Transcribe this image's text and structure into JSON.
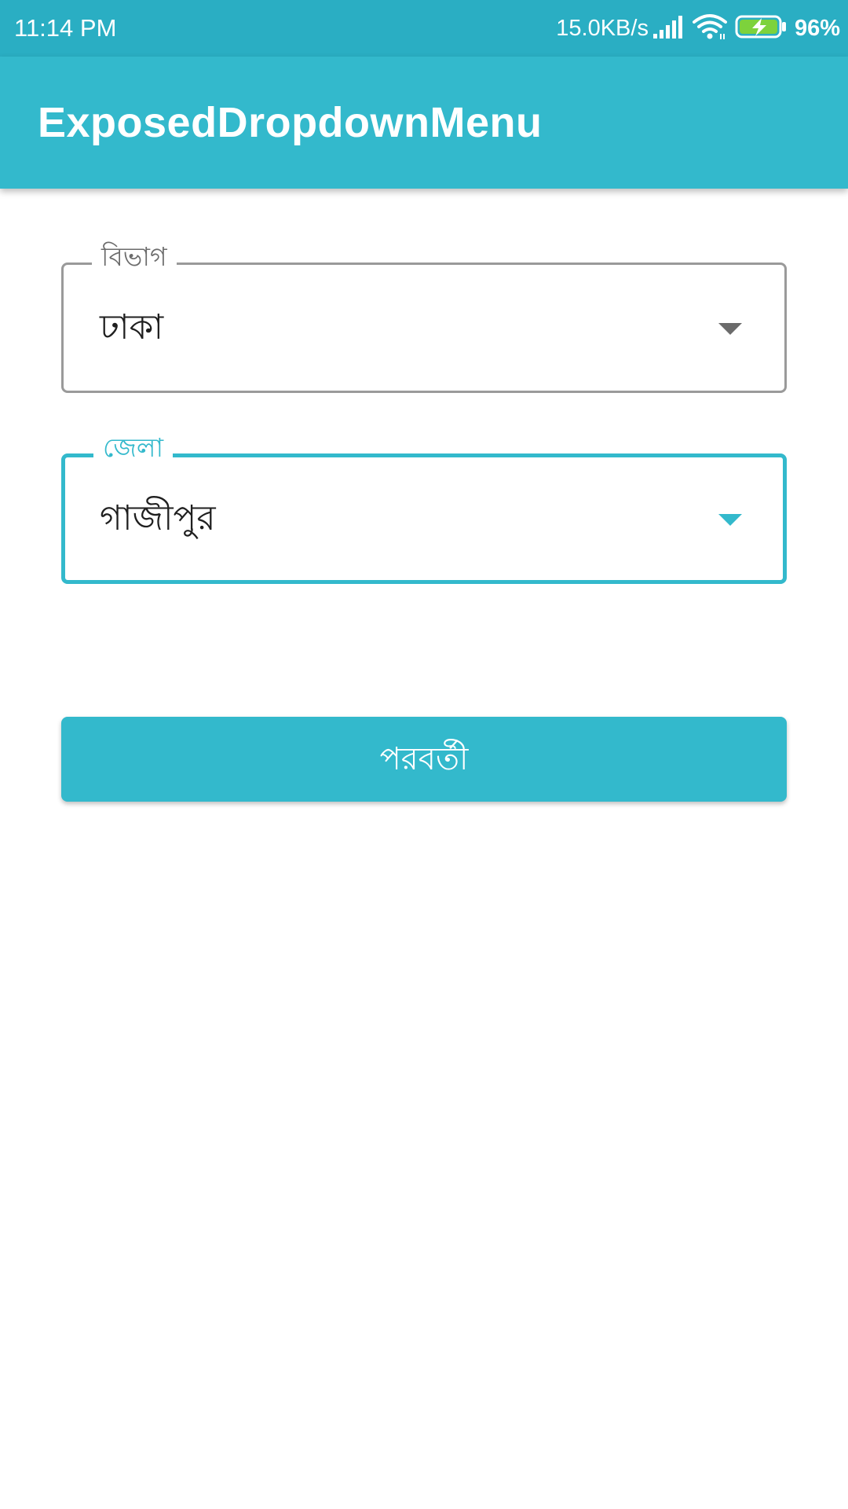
{
  "status_bar": {
    "time": "11:14 PM",
    "network_speed": "15.0KB/s",
    "battery_percent": "96%",
    "icons": [
      "signal-icon",
      "wifi-icon",
      "battery-charging-icon"
    ]
  },
  "app_bar": {
    "title": "ExposedDropdownMenu"
  },
  "form": {
    "division": {
      "label": "বিভাগ",
      "value": "ঢাকা"
    },
    "district": {
      "label": "জেলা",
      "value": "গাজীপুর"
    },
    "next_button_label": "পরবর্তী"
  },
  "colors": {
    "status_bar": "#2aaec3",
    "primary": "#33b9cc",
    "outline_inactive": "#9a9a9a",
    "label_inactive": "#6b6b6b",
    "text_primary": "#1f1f1f",
    "background": "#ffffff",
    "battery_fill": "#7dd23c"
  }
}
